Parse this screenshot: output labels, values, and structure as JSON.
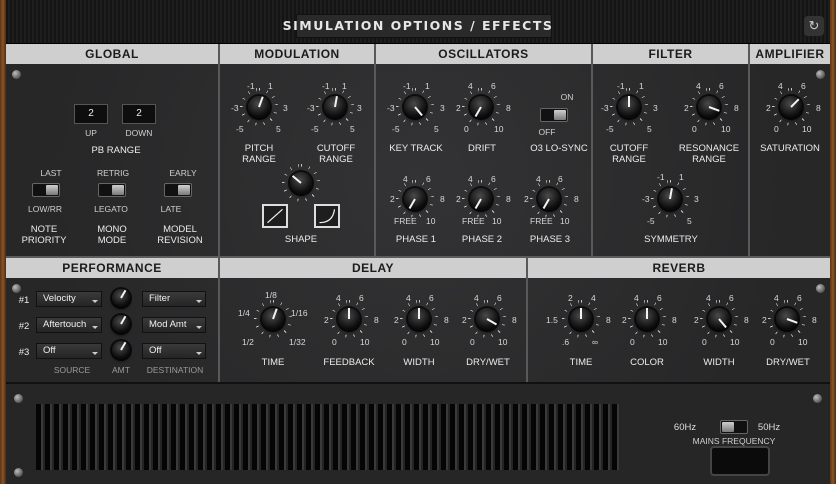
{
  "header": {
    "title": "SIMULATION OPTIONS / EFFECTS",
    "refresh_icon": "refresh-icon"
  },
  "sections": {
    "global": "GLOBAL",
    "modulation": "MODULATION",
    "oscillators": "OSCILLATORS",
    "filter": "FILTER",
    "amplifier": "AMPLIFIER",
    "performance": "PERFORMANCE",
    "delay": "DELAY",
    "reverb": "REVERB"
  },
  "global": {
    "pb_up": "2",
    "pb_down": "2",
    "up_label": "UP",
    "down_label": "DOWN",
    "pb_label": "PB RANGE",
    "note_priority": {
      "top": "LAST",
      "bottom": "LOW/RR",
      "label1": "NOTE",
      "label2": "PRIORITY"
    },
    "mono_mode": {
      "top": "RETRIG",
      "bottom": "LEGATO",
      "label1": "MONO",
      "label2": "MODE"
    },
    "model_revision": {
      "top": "EARLY",
      "bottom": "LATE",
      "label1": "MODEL",
      "label2": "REVISION"
    }
  },
  "scale": {
    "m1": "-1",
    "p1": "1",
    "m3": "-3",
    "p3": "3",
    "m5": "-5",
    "p5": "5",
    "n2": "2",
    "n4": "4",
    "n6": "6",
    "n8": "8",
    "n0": "0",
    "n10": "10",
    "free": "FREE",
    "r1_5": "1.5",
    "r6": ".6",
    "inf": "∞"
  },
  "modulation": {
    "pitch_range": [
      "PITCH",
      "RANGE"
    ],
    "cutoff_range": [
      "CUTOFF",
      "RANGE"
    ],
    "shape": "SHAPE"
  },
  "oscillators": {
    "key_track": "KEY TRACK",
    "drift": "DRIFT",
    "on": "ON",
    "off": "OFF",
    "o3_lo_sync": "O3 LO-SYNC",
    "phase1": "PHASE 1",
    "phase2": "PHASE 2",
    "phase3": "PHASE 3"
  },
  "filter": {
    "cutoff_range": [
      "CUTOFF",
      "RANGE"
    ],
    "resonance_range": [
      "RESONANCE",
      "RANGE"
    ],
    "symmetry": "SYMMETRY"
  },
  "amplifier": {
    "saturation": "SATURATION"
  },
  "performance": {
    "rows": [
      {
        "num": "#1",
        "source": "Velocity",
        "destination": "Filter"
      },
      {
        "num": "#2",
        "source": "Aftertouch",
        "destination": "Mod Amt"
      },
      {
        "num": "#3",
        "source": "Off",
        "destination": "Off"
      }
    ],
    "source_label": "SOURCE",
    "amt_label": "AMT",
    "destination_label": "DESTINATION"
  },
  "delay": {
    "time_scale": {
      "a": "1/8",
      "b": "1/4",
      "c": "1/16",
      "d": "1/2",
      "e": "1/32"
    },
    "time": "TIME",
    "feedback": "FEEDBACK",
    "width": "WIDTH",
    "drywet": "DRY/WET"
  },
  "reverb": {
    "time": "TIME",
    "color": "COLOR",
    "width": "WIDTH",
    "drywet": "DRY/WET"
  },
  "mains": {
    "hz60": "60Hz",
    "hz50": "50Hz",
    "label": "MAINS FREQUENCY"
  }
}
